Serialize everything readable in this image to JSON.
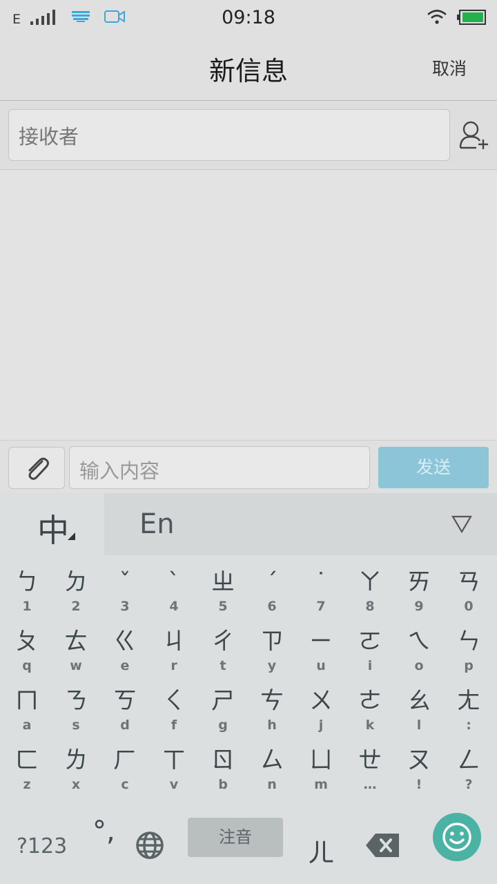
{
  "status": {
    "network": "E",
    "time": "09:18"
  },
  "header": {
    "title": "新信息",
    "cancel": "取消"
  },
  "recipient": {
    "placeholder": "接收者"
  },
  "compose": {
    "placeholder": "输入内容",
    "send": "发送"
  },
  "keyboard": {
    "lang_zh": "中",
    "lang_en": "En",
    "rows": [
      [
        {
          "g": "ㄅ",
          "s": "1"
        },
        {
          "g": "ㄉ",
          "s": "2"
        },
        {
          "g": "ˇ",
          "s": "3"
        },
        {
          "g": "ˋ",
          "s": "4"
        },
        {
          "g": "ㄓ",
          "s": "5"
        },
        {
          "g": "ˊ",
          "s": "6"
        },
        {
          "g": "˙",
          "s": "7"
        },
        {
          "g": "ㄚ",
          "s": "8"
        },
        {
          "g": "ㄞ",
          "s": "9"
        },
        {
          "g": "ㄢ",
          "s": "0"
        }
      ],
      [
        {
          "g": "ㄆ",
          "s": "q"
        },
        {
          "g": "ㄊ",
          "s": "w"
        },
        {
          "g": "ㄍ",
          "s": "e"
        },
        {
          "g": "ㄐ",
          "s": "r"
        },
        {
          "g": "ㄔ",
          "s": "t"
        },
        {
          "g": "ㄗ",
          "s": "y"
        },
        {
          "g": "ㄧ",
          "s": "u"
        },
        {
          "g": "ㄛ",
          "s": "i"
        },
        {
          "g": "ㄟ",
          "s": "o"
        },
        {
          "g": "ㄣ",
          "s": "p"
        }
      ],
      [
        {
          "g": "ㄇ",
          "s": "a"
        },
        {
          "g": "ㄋ",
          "s": "s"
        },
        {
          "g": "ㄎ",
          "s": "d"
        },
        {
          "g": "ㄑ",
          "s": "f"
        },
        {
          "g": "ㄕ",
          "s": "g"
        },
        {
          "g": "ㄘ",
          "s": "h"
        },
        {
          "g": "ㄨ",
          "s": "j"
        },
        {
          "g": "ㄜ",
          "s": "k"
        },
        {
          "g": "ㄠ",
          "s": "l"
        },
        {
          "g": "ㄤ",
          "s": ":"
        }
      ],
      [
        {
          "g": "ㄈ",
          "s": "z"
        },
        {
          "g": "ㄌ",
          "s": "x"
        },
        {
          "g": "ㄏ",
          "s": "c"
        },
        {
          "g": "ㄒ",
          "s": "v"
        },
        {
          "g": "ㄖ",
          "s": "b"
        },
        {
          "g": "ㄙ",
          "s": "n"
        },
        {
          "g": "ㄩ",
          "s": "m"
        },
        {
          "g": "ㄝ",
          "s": "…"
        },
        {
          "g": "ㄡ",
          "s": "!"
        },
        {
          "g": "ㄥ",
          "s": "?"
        }
      ]
    ],
    "num_key": "?123",
    "punct_key": "°,",
    "space_key": "注音",
    "er_key": "ㄦ"
  },
  "colors": {
    "send_button": "#8cc5d8",
    "emoji_button": "#4ab3a4",
    "status_icons": "#3aa8d8",
    "battery": "#22b14c"
  },
  "icons": {
    "signal": "signal-bars-icon",
    "keyboard": "keyboard-icon",
    "video": "video-camera-icon",
    "wifi": "wifi-icon",
    "battery": "battery-icon",
    "add_contact": "add-contact-icon",
    "attach": "paperclip-icon",
    "hide_keyboard": "triangle-down-icon",
    "globe": "globe-icon",
    "backspace": "backspace-icon",
    "emoji": "smiley-icon"
  }
}
